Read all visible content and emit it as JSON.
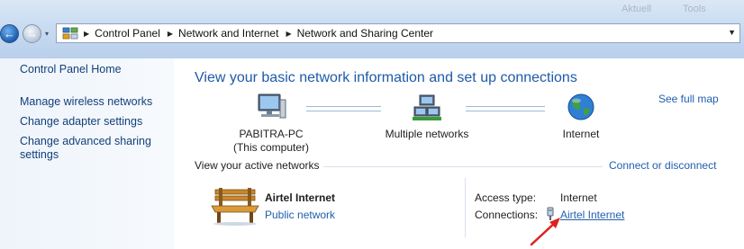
{
  "window": {
    "ghost_buttons": [
      "Aktuell",
      "Tools"
    ],
    "ghost_glyph": "—"
  },
  "nav": {
    "back_glyph": "←",
    "forward_glyph": "→",
    "dropdown_glyph": "▾"
  },
  "address": {
    "breadcrumbs": [
      "Control Panel",
      "Network and Internet",
      "Network and Sharing Center"
    ],
    "separator_glyph": "▶",
    "dropdown_glyph": "▼"
  },
  "sidebar": {
    "home_label": "Control Panel Home",
    "tasks": [
      "Manage wireless networks",
      "Change adapter settings",
      "Change advanced sharing settings"
    ]
  },
  "main": {
    "title": "View your basic network information and set up connections",
    "see_full_map": "See full map",
    "map": {
      "computer_name": "PABITRA-PC",
      "computer_sub": "(This computer)",
      "middle_label": "Multiple networks",
      "internet_label": "Internet"
    },
    "active_networks_heading": "View your active networks",
    "connect_disconnect": "Connect or disconnect",
    "network": {
      "name": "Airtel Internet",
      "type": "Public network",
      "access_type_label": "Access type:",
      "access_type_value": "Internet",
      "connections_label": "Connections:",
      "connections_value": "Airtel Internet"
    }
  },
  "colors": {
    "link": "#1f5fae",
    "title": "#1e5aa8",
    "arrow": "#e02020"
  }
}
